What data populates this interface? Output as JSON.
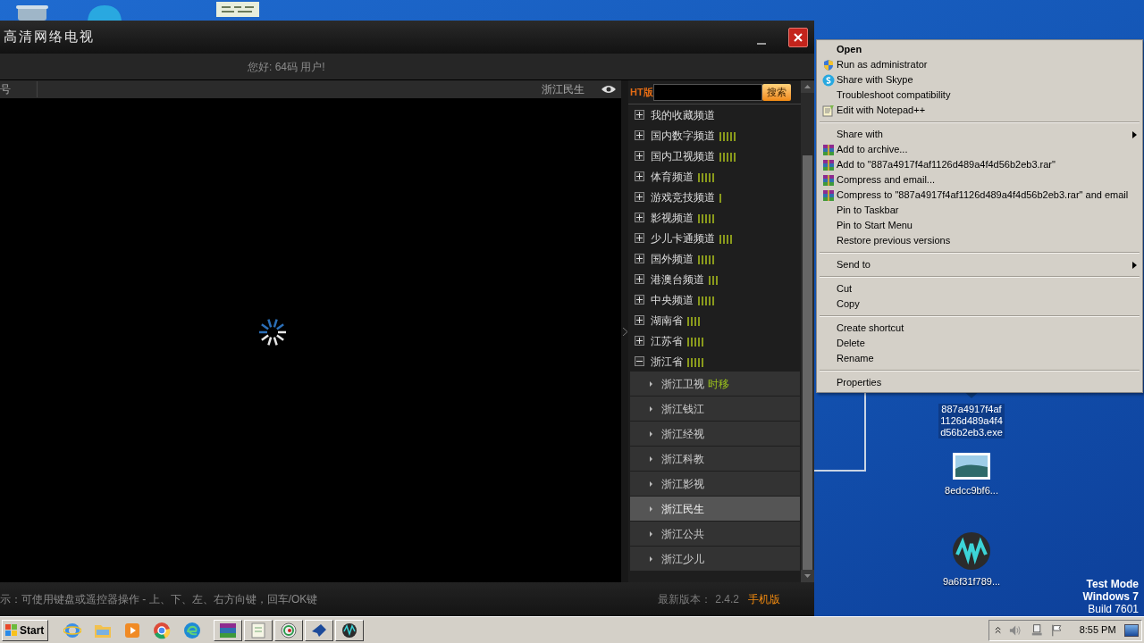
{
  "desktop_icons": [
    {
      "label": "887a4917f4af 1126d489a4f4 d56b2eb3.exe",
      "kind": "exe",
      "selected": true
    },
    {
      "label": "8edcc9bf6...",
      "kind": "image",
      "selected": false
    },
    {
      "label": "9a6f31f789...",
      "kind": "waves",
      "selected": false
    }
  ],
  "watermark_text": [
    "Test Mode",
    "Windows 7",
    "Build 7601"
  ],
  "app": {
    "title": "高清网络电视",
    "greeting": "您好: 64码 用户!",
    "header_left": "号",
    "header_channel": "浙江民生",
    "search": {
      "badge": "HT版",
      "button": "搜索"
    },
    "tree": [
      {
        "label": "我的收藏频道",
        "expanded": false,
        "kind": "plain"
      },
      {
        "label": "国内数字频道",
        "expanded": false,
        "kind": "five"
      },
      {
        "label": "国内卫视频道",
        "expanded": false,
        "kind": "five"
      },
      {
        "label": "体育频道",
        "expanded": false,
        "kind": "five"
      },
      {
        "label": "游戏竞技频道",
        "expanded": false,
        "kind": "one"
      },
      {
        "label": "影视频道",
        "expanded": false,
        "kind": "five"
      },
      {
        "label": "少儿卡通频道",
        "expanded": false,
        "kind": "four"
      },
      {
        "label": "国外频道",
        "expanded": false,
        "kind": "five"
      },
      {
        "label": "港澳台频道",
        "expanded": false,
        "kind": "three"
      },
      {
        "label": "中央频道",
        "expanded": false,
        "kind": "five"
      },
      {
        "label": "湖南省",
        "expanded": false,
        "kind": "four"
      },
      {
        "label": "江苏省",
        "expanded": false,
        "kind": "five"
      },
      {
        "label": "浙江省",
        "expanded": true,
        "kind": "five",
        "children": [
          {
            "label": "浙江卫视",
            "tag": "时移",
            "selected": false
          },
          {
            "label": "浙江钱江",
            "selected": false
          },
          {
            "label": "浙江经视",
            "selected": false
          },
          {
            "label": "浙江科教",
            "selected": false
          },
          {
            "label": "浙江影视",
            "selected": false
          },
          {
            "label": "浙江民生",
            "selected": true
          },
          {
            "label": "浙江公共",
            "selected": false
          },
          {
            "label": "浙江少儿",
            "selected": false
          }
        ]
      }
    ],
    "footer_hint": "示：可使用键盘或遥控器操作 - 上、下、左、右方向键，回车/OK键",
    "version_label": "最新版本：",
    "version": "2.4.2",
    "mobile_link": "手机版"
  },
  "context_menu": [
    [
      {
        "label": "Open",
        "kind": "plain",
        "default": true,
        "submenu": false
      },
      {
        "label": "Run as administrator",
        "kind": "admin",
        "default": false,
        "submenu": false
      },
      {
        "label": "Share with Skype",
        "kind": "skype",
        "default": false,
        "submenu": false
      },
      {
        "label": "Troubleshoot compatibility",
        "kind": "plain",
        "default": false,
        "submenu": false
      },
      {
        "label": "Edit with Notepad++",
        "kind": "notepad",
        "default": false,
        "submenu": false
      }
    ],
    [
      {
        "label": "Share with",
        "kind": "plain",
        "default": false,
        "submenu": true
      },
      {
        "label": "Add to archive...",
        "kind": "archive",
        "default": false,
        "submenu": false
      },
      {
        "label": "Add to \"887a4917f4af1126d489a4f4d56b2eb3.rar\"",
        "kind": "archive",
        "default": false,
        "submenu": false
      },
      {
        "label": "Compress and email...",
        "kind": "archive",
        "default": false,
        "submenu": false
      },
      {
        "label": "Compress to \"887a4917f4af1126d489a4f4d56b2eb3.rar\" and email",
        "kind": "archive",
        "default": false,
        "submenu": false
      },
      {
        "label": "Pin to Taskbar",
        "kind": "plain",
        "default": false,
        "submenu": false
      },
      {
        "label": "Pin to Start Menu",
        "kind": "plain",
        "default": false,
        "submenu": false
      },
      {
        "label": "Restore previous versions",
        "kind": "plain",
        "default": false,
        "submenu": false
      }
    ],
    [
      {
        "label": "Send to",
        "kind": "plain",
        "default": false,
        "submenu": true
      }
    ],
    [
      {
        "label": "Cut",
        "kind": "plain",
        "default": false,
        "submenu": false
      },
      {
        "label": "Copy",
        "kind": "plain",
        "default": false,
        "submenu": false
      }
    ],
    [
      {
        "label": "Create shortcut",
        "kind": "plain",
        "default": false,
        "submenu": false
      },
      {
        "label": "Delete",
        "kind": "plain",
        "default": false,
        "submenu": false
      },
      {
        "label": "Rename",
        "kind": "plain",
        "default": false,
        "submenu": false
      }
    ],
    [
      {
        "label": "Properties",
        "kind": "plain",
        "default": false,
        "submenu": false
      }
    ]
  ],
  "taskbar": {
    "start": "Start",
    "clock": "8:55 PM"
  }
}
